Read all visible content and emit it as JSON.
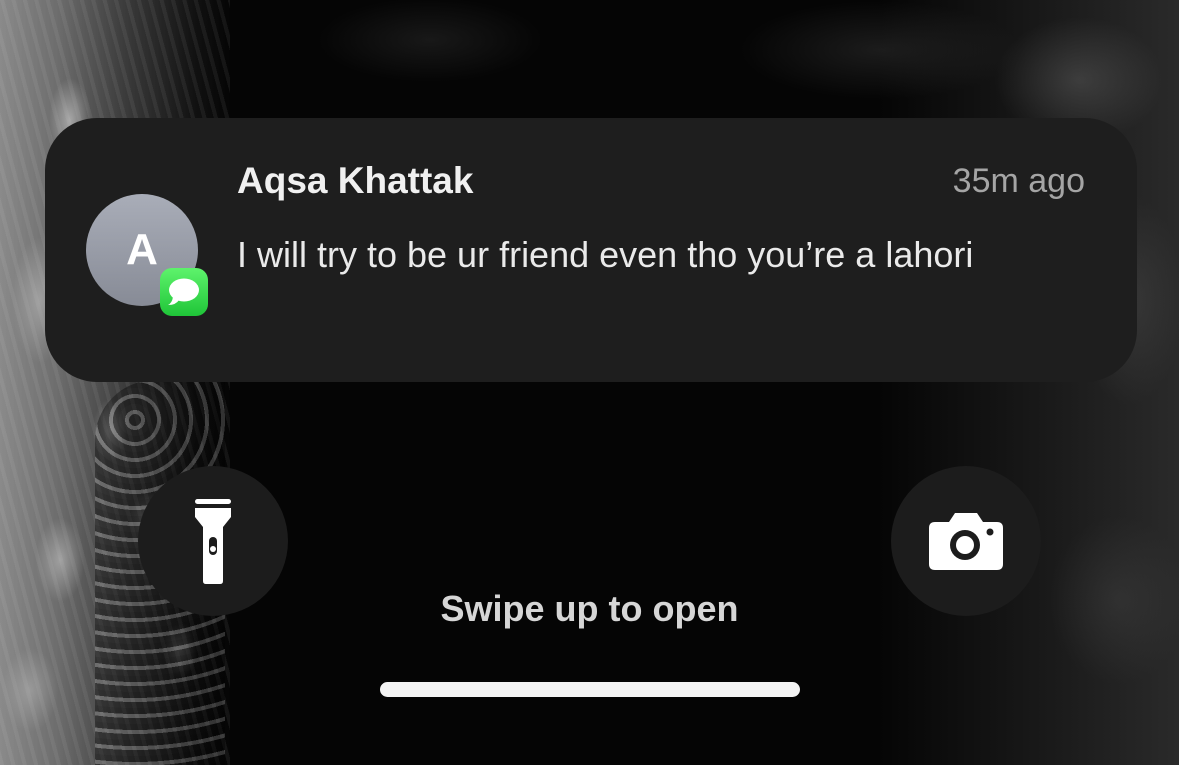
{
  "notification": {
    "avatar_initial": "A",
    "app_icon": "messages-icon",
    "sender": "Aqsa Khattak",
    "time": "35m ago",
    "message": "I will try to be ur friend even tho you’re a lahori"
  },
  "quick_actions": {
    "flashlight_icon": "flashlight-icon",
    "camera_icon": "camera-icon"
  },
  "lock_screen": {
    "swipe_hint": "Swipe up to open"
  },
  "colors": {
    "card_background": "#1e1e1e",
    "messages_green": "#2ad046",
    "avatar_grey": "#9a9ea9"
  }
}
